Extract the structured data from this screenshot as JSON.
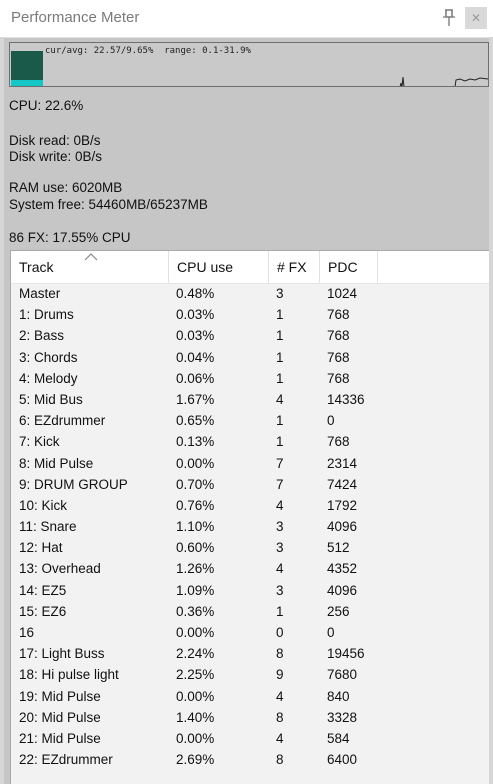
{
  "window": {
    "title": "Performance Meter",
    "close_glyph": "✕"
  },
  "graph": {
    "label": "cur/avg: 22.57/9.65%  range: 0.1-31.9%",
    "bar_color": "#1a5a4a",
    "accent_color": "#14c6c6"
  },
  "stats": {
    "cpu": "CPU: 22.6%",
    "disk_read": "Disk read: 0B/s",
    "disk_write": "Disk write: 0B/s",
    "ram_use": "RAM use: 6020MB",
    "system_free": "System free: 54460MB/65237MB",
    "fx_cpu": "86 FX: 17.55% CPU"
  },
  "table": {
    "columns": [
      "Track",
      "CPU use",
      "# FX",
      "PDC"
    ],
    "sorted_column": "Track",
    "rows": [
      {
        "track": "Master",
        "cpu": "0.48%",
        "fx": "3",
        "pdc": "1024"
      },
      {
        "track": "1: Drums",
        "cpu": "0.03%",
        "fx": "1",
        "pdc": "768"
      },
      {
        "track": "2: Bass",
        "cpu": "0.03%",
        "fx": "1",
        "pdc": "768"
      },
      {
        "track": "3: Chords",
        "cpu": "0.04%",
        "fx": "1",
        "pdc": "768"
      },
      {
        "track": "4: Melody",
        "cpu": "0.06%",
        "fx": "1",
        "pdc": "768"
      },
      {
        "track": "5: Mid Bus",
        "cpu": "1.67%",
        "fx": "4",
        "pdc": "14336"
      },
      {
        "track": "6: EZdrummer",
        "cpu": "0.65%",
        "fx": "1",
        "pdc": "0"
      },
      {
        "track": "7: Kick",
        "cpu": "0.13%",
        "fx": "1",
        "pdc": "768"
      },
      {
        "track": "8: Mid Pulse",
        "cpu": "0.00%",
        "fx": "7",
        "pdc": "2314"
      },
      {
        "track": "9: DRUM GROUP",
        "cpu": "0.70%",
        "fx": "7",
        "pdc": "7424"
      },
      {
        "track": "10: Kick",
        "cpu": "0.76%",
        "fx": "4",
        "pdc": "1792"
      },
      {
        "track": "11: Snare",
        "cpu": "1.10%",
        "fx": "3",
        "pdc": "4096"
      },
      {
        "track": "12: Hat",
        "cpu": "0.60%",
        "fx": "3",
        "pdc": "512"
      },
      {
        "track": "13: Overhead",
        "cpu": "1.26%",
        "fx": "4",
        "pdc": "4352"
      },
      {
        "track": "14: EZ5",
        "cpu": "1.09%",
        "fx": "3",
        "pdc": "4096"
      },
      {
        "track": "15: EZ6",
        "cpu": "0.36%",
        "fx": "1",
        "pdc": "256"
      },
      {
        "track": "16",
        "cpu": "0.00%",
        "fx": "0",
        "pdc": "0"
      },
      {
        "track": "17: Light Buss",
        "cpu": "2.24%",
        "fx": "8",
        "pdc": "19456"
      },
      {
        "track": "18: Hi pulse light",
        "cpu": "2.25%",
        "fx": "9",
        "pdc": "7680"
      },
      {
        "track": "19: Mid Pulse",
        "cpu": "0.00%",
        "fx": "4",
        "pdc": "840"
      },
      {
        "track": "20: Mid Pulse",
        "cpu": "1.40%",
        "fx": "8",
        "pdc": "3328"
      },
      {
        "track": "21: Mid Pulse",
        "cpu": "0.00%",
        "fx": "4",
        "pdc": "584"
      },
      {
        "track": "22: EZdrummer",
        "cpu": "2.69%",
        "fx": "8",
        "pdc": "6400"
      }
    ]
  },
  "icons": {
    "pin": "pin-icon",
    "close": "close-icon",
    "sort": "sort-ascending-icon"
  }
}
